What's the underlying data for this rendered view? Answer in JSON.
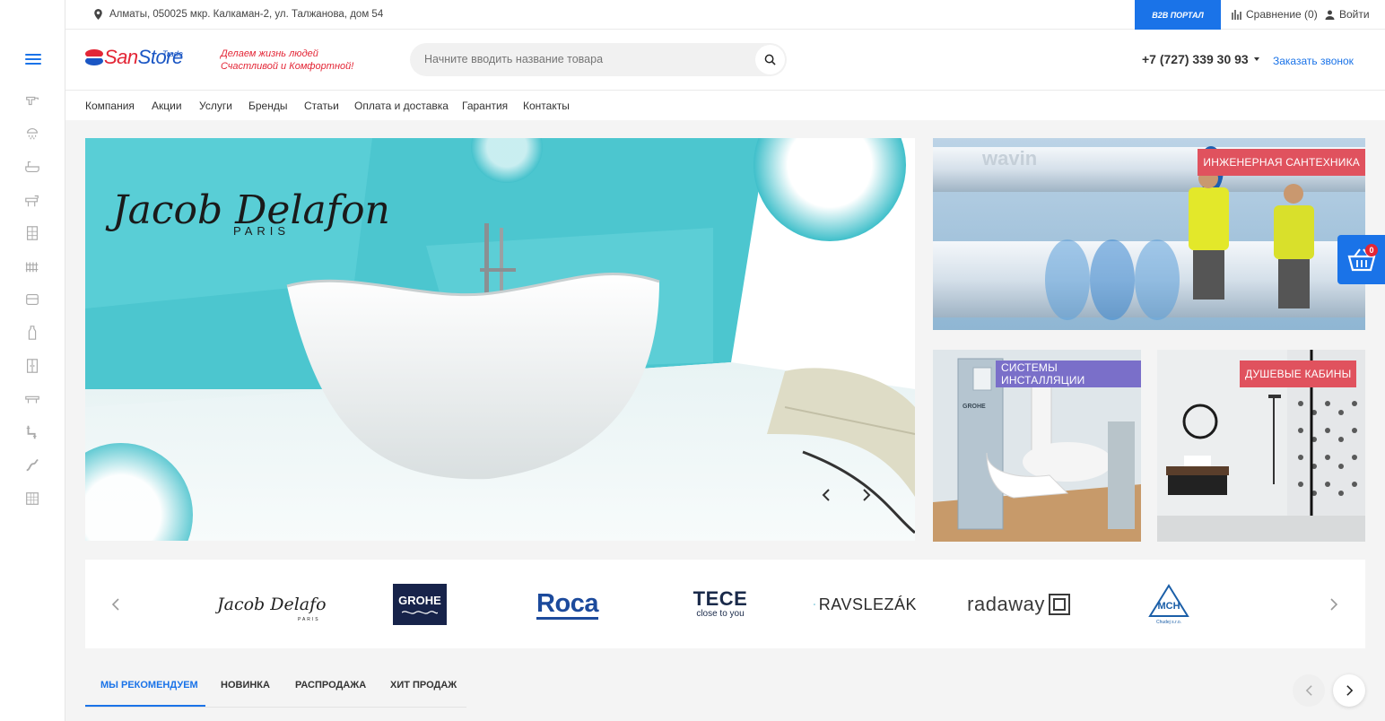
{
  "topbar": {
    "address": "Алматы, 050025 мкр. Калкаман-2, ул. Талжанова, дом 54",
    "b2b_label": "B2B ПОРТАЛ",
    "compare_label": "Сравнение (0)",
    "login_label": "Войти"
  },
  "header": {
    "logo_part1": "San",
    "logo_part2": "Store",
    "logo_sub": "Trade",
    "slogan_line1": "Делаем жизнь людей",
    "slogan_line2": "Счастливой и Комфортной!",
    "search_placeholder": "Начните вводить название товара",
    "phone": "+7 (727) 339 30 93",
    "callback_label": "Заказать звонок"
  },
  "nav": {
    "items": [
      "Компания",
      "Акции",
      "Услуги",
      "Бренды",
      "Статьи",
      "Оплата и доставка",
      "Гарантия",
      "Контакты"
    ]
  },
  "hero": {
    "brand_script": "Jacob Delafon",
    "brand_city": "PARIS"
  },
  "banners": {
    "engineering": "ИНЖЕНЕРНАЯ САНТЕХНИКА",
    "engineering_brand": "wavin",
    "installation": "СИСТЕМЫ ИНСТАЛЛЯЦИИ",
    "installation_brand": "GROHE",
    "shower": "ДУШЕВЫЕ КАБИНЫ"
  },
  "cart": {
    "count": "0"
  },
  "brands": {
    "items": [
      "Jacob Delafon",
      "GROHE",
      "Roca",
      "TECE",
      "RAVSLEZÁK",
      "radaway",
      "MCH"
    ],
    "jacob_sub": "PARIS",
    "tece_sub": "close to you",
    "mch_sub": "Chudej s.r.o."
  },
  "tabs": {
    "items": [
      "МЫ РЕКОМЕНДУЕМ",
      "НОВИНКА",
      "РАСПРОДАЖА",
      "ХИТ ПРОДАЖ"
    ]
  },
  "colors": {
    "accent": "#1a73e8",
    "brand_red": "#e32636",
    "label_red": "#e0525e",
    "label_purple": "#7a6fc9"
  },
  "sidebar": {
    "icons": [
      "faucet-icon",
      "shower-head-icon",
      "bathtub-icon",
      "sink-icon",
      "shower-cabin-icon",
      "radiator-icon",
      "toilet-icon",
      "bottle-icon",
      "cabinet-icon",
      "shelf-icon",
      "pipe-icon",
      "hose-icon",
      "tile-icon"
    ]
  }
}
